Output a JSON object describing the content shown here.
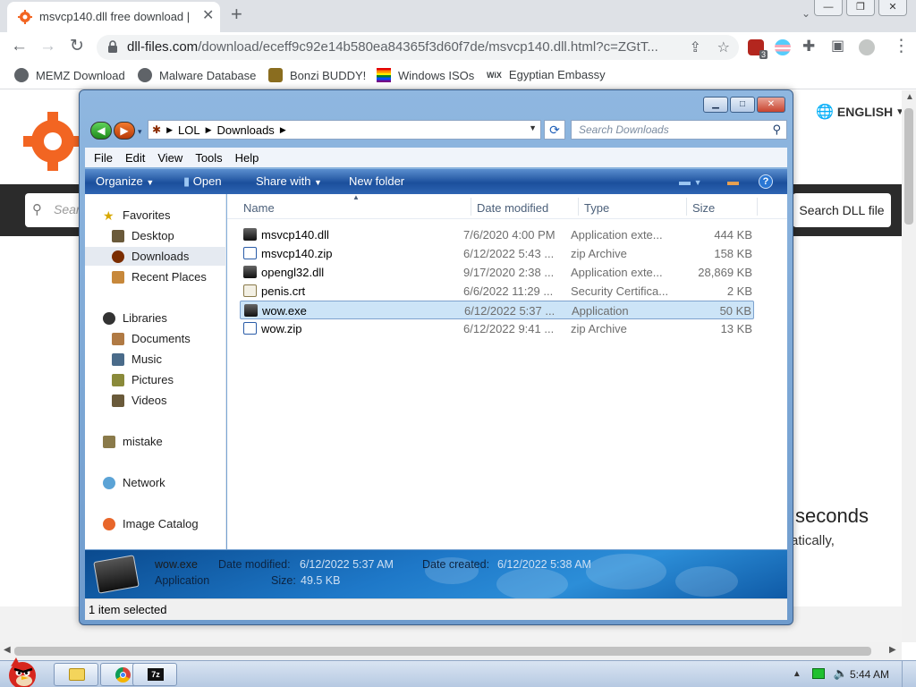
{
  "browser": {
    "tab": {
      "title": "msvcp140.dll free download |"
    },
    "address": {
      "host": "dll-files.com",
      "path": "/download/eceff9c92e14b580ea84365f3d60f7de/msvcp140.dll.html?c=ZGtT..."
    },
    "extension_badge": "3",
    "bookmarks": [
      {
        "label": "MEMZ Download"
      },
      {
        "label": "Malware Database"
      },
      {
        "label": "Bonzi BUDDY!"
      },
      {
        "label": "Windows ISOs"
      },
      {
        "label": "Egyptian Embassy"
      }
    ]
  },
  "webpage": {
    "language": "ENGLISH",
    "search_placeholder": "Searc",
    "search_button": "Search DLL file",
    "countdown_text": "seconds",
    "countdown_sub": "atically,"
  },
  "explorer": {
    "breadcrumb": [
      "LOL",
      "Downloads"
    ],
    "search_placeholder": "Search Downloads",
    "menu": [
      "File",
      "Edit",
      "View",
      "Tools",
      "Help"
    ],
    "commands": {
      "organize": "Organize",
      "open": "Open",
      "share": "Share with",
      "new_folder": "New folder"
    },
    "nav": {
      "favorites": "Favorites",
      "desktop": "Desktop",
      "downloads": "Downloads",
      "recent": "Recent Places",
      "libraries": "Libraries",
      "documents": "Documents",
      "music": "Music",
      "pictures": "Pictures",
      "videos": "Videos",
      "user": "mistake",
      "network": "Network",
      "image_catalog": "Image Catalog"
    },
    "columns": {
      "name": "Name",
      "date": "Date modified",
      "type": "Type",
      "size": "Size"
    },
    "files": [
      {
        "name": "msvcp140.dll",
        "date": "7/6/2020 4:00 PM",
        "type": "Application exte...",
        "size": "444 KB",
        "icon": "dll-icon",
        "selected": false
      },
      {
        "name": "msvcp140.zip",
        "date": "6/12/2022 5:43 ...",
        "type": "zip Archive",
        "size": "158 KB",
        "icon": "zip-icon",
        "selected": false
      },
      {
        "name": "opengl32.dll",
        "date": "9/17/2020 2:38 ...",
        "type": "Application exte...",
        "size": "28,869 KB",
        "icon": "dll-icon",
        "selected": false
      },
      {
        "name": "penis.crt",
        "date": "6/6/2022 11:29 ...",
        "type": "Security Certifica...",
        "size": "2 KB",
        "icon": "certificate-icon",
        "selected": false
      },
      {
        "name": "wow.exe",
        "date": "6/12/2022 5:37 ...",
        "type": "Application",
        "size": "50 KB",
        "icon": "exe-icon",
        "selected": true
      },
      {
        "name": "wow.zip",
        "date": "6/12/2022 9:41 ...",
        "type": "zip Archive",
        "size": "13 KB",
        "icon": "zip-icon",
        "selected": false
      }
    ],
    "details": {
      "name": "wow.exe",
      "type": "Application",
      "modified_label": "Date modified:",
      "modified": "6/12/2022 5:37 AM",
      "created_label": "Date created:",
      "created": "6/12/2022 5:38 AM",
      "size_label": "Size:",
      "size": "49.5 KB"
    },
    "status": "1 item selected"
  },
  "taskbar": {
    "time": "5:44 AM"
  },
  "colors": {
    "chrome_tab_bg": "#dee1e6",
    "page_dark_bar": "#2b2b2b",
    "explorer_cmdbar": "#1b4f9c",
    "selection": "#cce4f7"
  }
}
